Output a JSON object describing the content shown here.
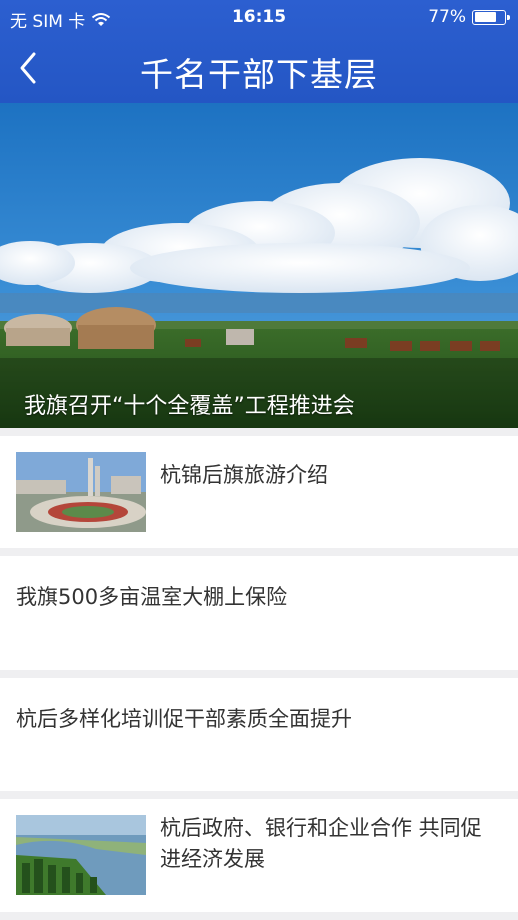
{
  "status": {
    "carrier": "无 SIM 卡",
    "time": "16:15",
    "battery_text": "77%",
    "battery_level": 0.77
  },
  "nav": {
    "title": "千名干部下基层",
    "back_icon": "chevron-left-icon"
  },
  "hero": {
    "caption": "我旗召开“十个全覆盖”工程推进会"
  },
  "articles": [
    {
      "title": "杭锦后旗旅游介绍",
      "thumb": "monument-roundabout"
    },
    {
      "title": "我旗500多亩温室大棚上保险"
    },
    {
      "title": "杭后多样化培训促干部素质全面提升"
    },
    {
      "title": "杭后政府、银行和企业合作 共同促进经济发展",
      "thumb": "lake-forest"
    }
  ],
  "colors": {
    "header": "#2456c4",
    "background": "#efeff1",
    "text": "#333333"
  }
}
